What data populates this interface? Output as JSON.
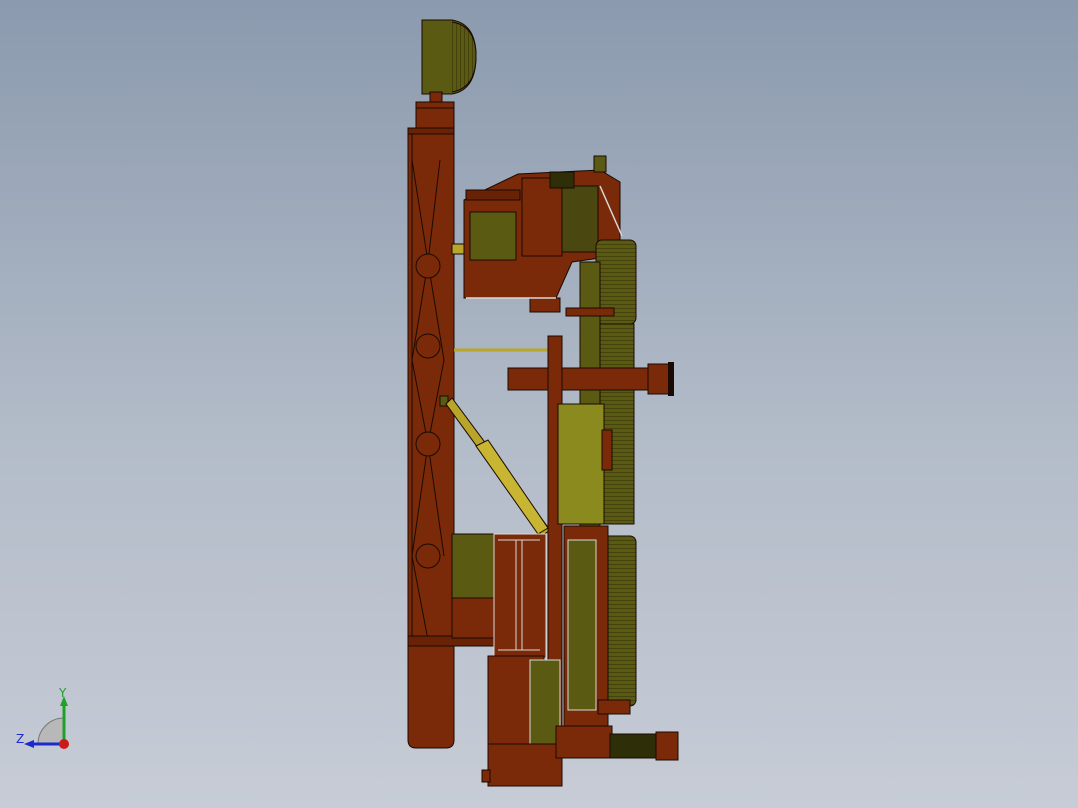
{
  "viewport": {
    "background_top": "#8b9aae",
    "background_bottom": "#c7ccd6"
  },
  "model": {
    "description_icon": "drilling-rig-3d-model",
    "colors": {
      "body": "#7a2a08",
      "body_dark": "#4a1a06",
      "olive": "#5b5a12",
      "olive_light": "#8b8a1e",
      "yellow": "#b8a52a",
      "edge": "#1a0a02",
      "steel_hi": "#d8d8d8"
    }
  },
  "triad": {
    "y_label": "Y",
    "z_label": "Z",
    "y_color": "#1fa02a",
    "z_color": "#1a2acc",
    "x_color": "#cc1a1a"
  }
}
